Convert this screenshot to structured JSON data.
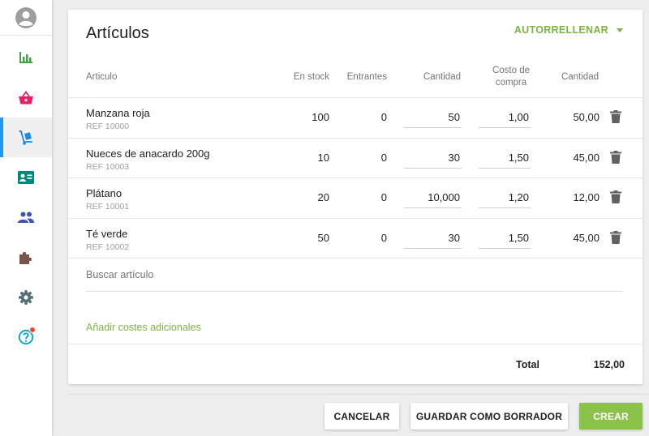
{
  "sidebar": {
    "items": [
      {
        "icon": "bar-chart-icon",
        "color": "#43a047"
      },
      {
        "icon": "basket-icon",
        "color": "#e91e63"
      },
      {
        "icon": "hand-truck-icon",
        "color": "#1e88e5",
        "active": true
      },
      {
        "icon": "contact-card-icon",
        "color": "#00897b"
      },
      {
        "icon": "people-icon",
        "color": "#3f51b5"
      },
      {
        "icon": "puzzle-icon",
        "color": "#795548"
      },
      {
        "icon": "gear-icon",
        "color": "#546e7a"
      },
      {
        "icon": "help-icon",
        "color": "#039be5"
      }
    ],
    "accent": "#2196f3"
  },
  "card": {
    "title": "Artículos",
    "autofill_label": "AUTORRELLENAR"
  },
  "table": {
    "headers": {
      "article": "Articulo",
      "in_stock": "En stock",
      "incoming": "Entrantes",
      "quantity": "Cantidad",
      "purchase_cost_line1": "Costo de",
      "purchase_cost_line2": "compra",
      "total_quantity": "Cantidad"
    },
    "rows": [
      {
        "name": "Manzana roja",
        "ref": "REF 10000",
        "in_stock": "100",
        "incoming": "0",
        "quantity": "50",
        "cost": "1,00",
        "amount": "50,00"
      },
      {
        "name": "Nueces de anacardo 200g",
        "ref": "REF 10003",
        "in_stock": "10",
        "incoming": "0",
        "quantity": "30",
        "cost": "1,50",
        "amount": "45,00"
      },
      {
        "name": "Plátano",
        "ref": "REF 10001",
        "in_stock": "20",
        "incoming": "0",
        "quantity": "10,000",
        "cost": "1,20",
        "amount": "12,00"
      },
      {
        "name": "Té verde",
        "ref": "REF 10002",
        "in_stock": "50",
        "incoming": "0",
        "quantity": "30",
        "cost": "1,50",
        "amount": "45,00"
      }
    ]
  },
  "search": {
    "placeholder": "Buscar artículo"
  },
  "add_costs_label": "Añadir costes adicionales",
  "total": {
    "label": "Total",
    "value": "152,00"
  },
  "buttons": {
    "cancel": "CANCELAR",
    "save_draft": "GUARDAR COMO BORRADOR",
    "create": "CREAR"
  },
  "colors": {
    "green": "#7cb342",
    "primary_button": "#8bc34a",
    "badge": "#f44336"
  }
}
